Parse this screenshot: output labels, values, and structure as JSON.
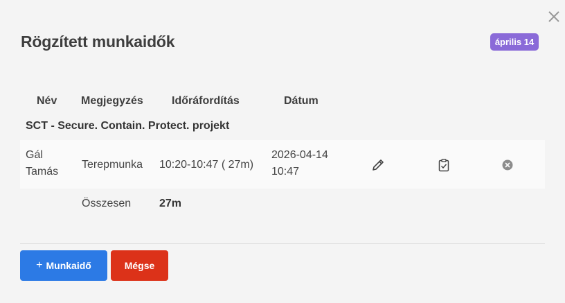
{
  "modal": {
    "title": "Rögzített munkaidők",
    "date_badge": "április 14",
    "accent_color": "#8a6ad8"
  },
  "table": {
    "headers": [
      "Név",
      "Megjegyzés",
      "Időráfordítás",
      "Dátum"
    ],
    "group_title": "SCT - Secure. Contain. Protect. projekt",
    "rows": [
      {
        "name_line1": "Gál",
        "name_line2": "Tamás",
        "note": "Terepmunka",
        "time": "10:20-10:47 ( 27m)",
        "date_line1": "2026-04-14",
        "date_line2": "10:47",
        "actions": [
          "pencil-icon",
          "clipboard-check-icon",
          "remove-circle-icon"
        ]
      }
    ],
    "total_label": "Összesen",
    "total_value": "27m"
  },
  "footer": {
    "add_label": "Munkaidő",
    "add_icon": "+",
    "cancel_label": "Mégse",
    "primary_color": "#2c7ae5",
    "danger_color": "#dc3219"
  }
}
